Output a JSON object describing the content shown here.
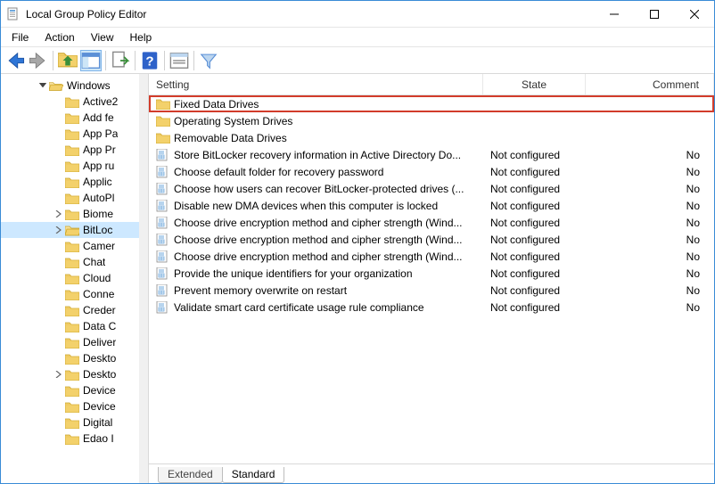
{
  "window": {
    "title": "Local Group Policy Editor"
  },
  "menu": {
    "file": "File",
    "action": "Action",
    "view": "View",
    "help": "Help"
  },
  "tree": {
    "root": {
      "label": "Windows ",
      "expanded": true
    },
    "items": [
      {
        "label": "Active2",
        "expandable": false
      },
      {
        "label": "Add fe",
        "expandable": false
      },
      {
        "label": "App Pa",
        "expandable": false
      },
      {
        "label": "App Pr",
        "expandable": false
      },
      {
        "label": "App ru",
        "expandable": false
      },
      {
        "label": "Applic",
        "expandable": false
      },
      {
        "label": "AutoPl",
        "expandable": false
      },
      {
        "label": "Biome",
        "expandable": true
      },
      {
        "label": "BitLoc",
        "expandable": true,
        "selected": true
      },
      {
        "label": "Camer",
        "expandable": false
      },
      {
        "label": "Chat",
        "expandable": false
      },
      {
        "label": "Cloud",
        "expandable": false
      },
      {
        "label": "Conne",
        "expandable": false
      },
      {
        "label": "Creder",
        "expandable": false
      },
      {
        "label": "Data C",
        "expandable": false
      },
      {
        "label": "Deliver",
        "expandable": false
      },
      {
        "label": "Deskto",
        "expandable": false
      },
      {
        "label": "Deskto",
        "expandable": true
      },
      {
        "label": "Device",
        "expandable": false
      },
      {
        "label": "Device",
        "expandable": false
      },
      {
        "label": "Digital",
        "expandable": false
      },
      {
        "label": "Edao I",
        "expandable": false
      }
    ]
  },
  "list": {
    "headers": {
      "setting": "Setting",
      "state": "State",
      "comment": "Comment"
    },
    "folders": [
      {
        "name": "Fixed Data Drives",
        "highlight": true
      },
      {
        "name": "Operating System Drives",
        "highlight": false
      },
      {
        "name": "Removable Data Drives",
        "highlight": false
      }
    ],
    "policies": [
      {
        "name": "Store BitLocker recovery information in Active Directory Do...",
        "state": "Not configured",
        "comment": "No"
      },
      {
        "name": "Choose default folder for recovery password",
        "state": "Not configured",
        "comment": "No"
      },
      {
        "name": "Choose how users can recover BitLocker-protected drives (...",
        "state": "Not configured",
        "comment": "No"
      },
      {
        "name": "Disable new DMA devices when this computer is locked",
        "state": "Not configured",
        "comment": "No"
      },
      {
        "name": "Choose drive encryption method and cipher strength (Wind...",
        "state": "Not configured",
        "comment": "No"
      },
      {
        "name": "Choose drive encryption method and cipher strength (Wind...",
        "state": "Not configured",
        "comment": "No"
      },
      {
        "name": "Choose drive encryption method and cipher strength (Wind...",
        "state": "Not configured",
        "comment": "No"
      },
      {
        "name": "Provide the unique identifiers for your organization",
        "state": "Not configured",
        "comment": "No"
      },
      {
        "name": "Prevent memory overwrite on restart",
        "state": "Not configured",
        "comment": "No"
      },
      {
        "name": "Validate smart card certificate usage rule compliance",
        "state": "Not configured",
        "comment": "No"
      }
    ]
  },
  "tabs": {
    "extended": "Extended",
    "standard": "Standard"
  }
}
